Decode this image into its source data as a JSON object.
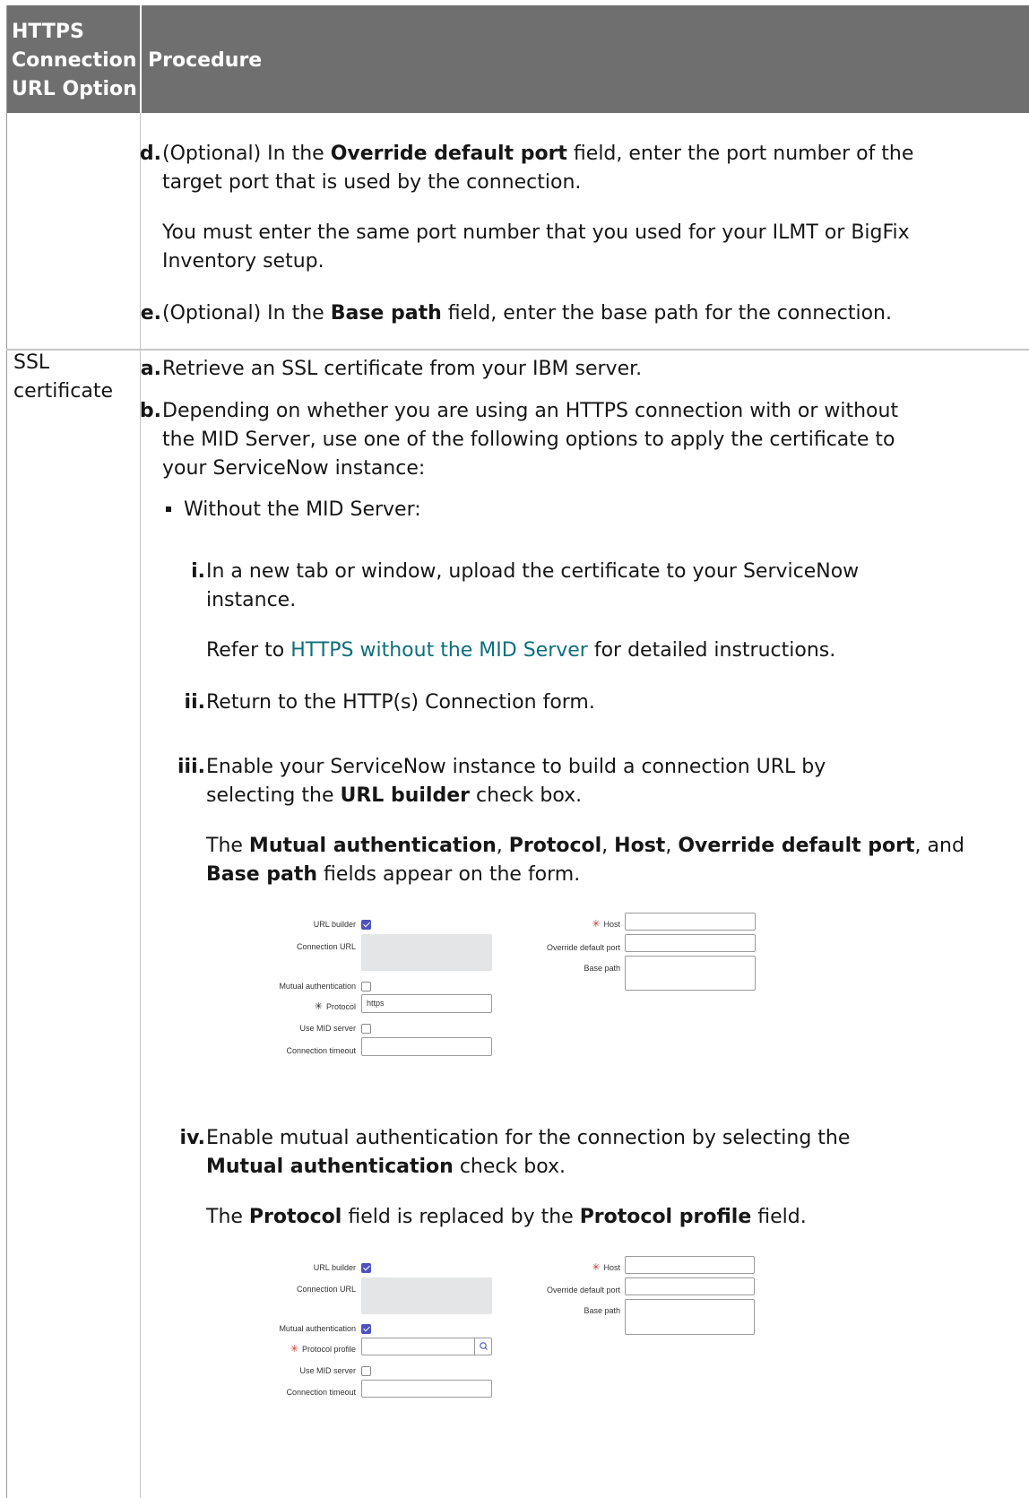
{
  "header": {
    "col1": "HTTPS Connection URL Option",
    "col1_lines": [
      "HTTPS",
      "Connection",
      "URL Option"
    ],
    "col2": "Procedure"
  },
  "rows": [
    {
      "steps": [
        {
          "marker": "d.",
          "line1_pre": "(Optional) In the ",
          "line1_bold": "Override default port",
          "line1_post": " field, enter the port number of the",
          "line2": "target port that is used by the connection.",
          "note_line1": "You must enter the same port number that you used for your ILMT or BigFix",
          "note_line2": "Inventory setup."
        },
        {
          "marker": "e.",
          "pre": "(Optional) In the ",
          "bold": "Base path",
          "post": " field, enter the base path for the connection."
        }
      ]
    },
    {
      "option_lines": [
        "SSL",
        "certificate"
      ],
      "step_a": {
        "marker": "a.",
        "text": "Retrieve an SSL certificate from your IBM server."
      },
      "step_b": {
        "marker": "b.",
        "line1": "Depending on whether you are using an HTTPS connection with or without",
        "line2": "the MID Server, use one of the following options to apply the certificate to",
        "line3": "your ServiceNow instance:",
        "bullet": "Without the MID Server:",
        "substeps": {
          "i": {
            "marker": "i.",
            "line1": "In a new tab or window, upload the certificate to your ServiceNow",
            "line2": "instance.",
            "refer_pre": "Refer to ",
            "refer_link": "HTTPS without the MID Server",
            "refer_post": " for detailed instructions."
          },
          "ii": {
            "marker": "ii.",
            "text": "Return to the HTTP(s) Connection form."
          },
          "iii": {
            "marker": "iii.",
            "line1": "Enable your ServiceNow instance to build a connection URL by",
            "line2_pre": "selecting the ",
            "line2_bold": "URL builder",
            "line2_post": " check box.",
            "res1_pre": "The ",
            "res1_b1": "Mutual authentication",
            "res1_s1": ", ",
            "res1_b2": "Protocol",
            "res1_s2": ", ",
            "res1_b3": "Host",
            "res1_s3": ", ",
            "res1_b4": "Override default port",
            "res1_s4": ", and",
            "res2_b": "Base path",
            "res2_post": " fields appear on the form."
          },
          "iv": {
            "marker": "iv.",
            "line1": "Enable mutual authentication for the connection by selecting the",
            "line2_bold": "Mutual authentication",
            "line2_post": " check box.",
            "res_pre": "The ",
            "res_b1": "Protocol",
            "res_mid": " field is replaced by the ",
            "res_b2": "Protocol profile",
            "res_post": " field."
          }
        }
      }
    }
  ],
  "form1": {
    "url_builder": "URL builder",
    "connection_url": "Connection URL",
    "mutual_auth": "Mutual authentication",
    "protocol": "Protocol",
    "protocol_value": "https",
    "use_mid": "Use MID server",
    "timeout": "Connection timeout",
    "host": "Host",
    "override_port": "Override default port",
    "base_path": "Base path",
    "required_mark": "✳"
  },
  "form2": {
    "url_builder": "URL builder",
    "connection_url": "Connection URL",
    "mutual_auth": "Mutual authentication",
    "protocol_profile": "Protocol profile",
    "use_mid": "Use MID server",
    "timeout": "Connection timeout",
    "host": "Host",
    "override_port": "Override default port",
    "base_path": "Base path",
    "required_mark": "✳"
  },
  "colors": {
    "header_bg": "#6f6f6f",
    "link": "#0f6e7c",
    "checkbox_on": "#4f52bd",
    "required": "#d0342c"
  }
}
